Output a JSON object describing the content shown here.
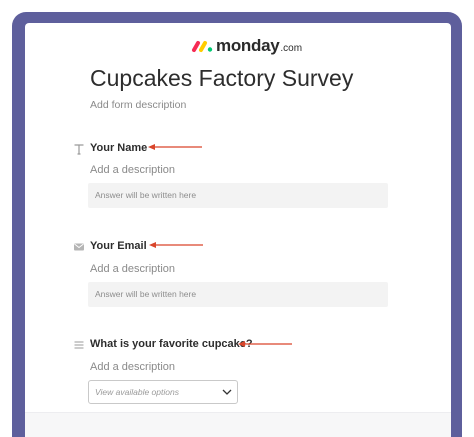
{
  "logo": {
    "word": "monday",
    "domain": ".com"
  },
  "form": {
    "title": "Cupcakes Factory Survey",
    "description": "Add form description"
  },
  "questions": [
    {
      "title": "Your Name",
      "description": "Add a description",
      "icon": "text-icon",
      "answer_placeholder": "Answer will be written here"
    },
    {
      "title": "Your Email",
      "description": "Add a description",
      "icon": "email-icon",
      "answer_placeholder": "Answer will be written here"
    },
    {
      "title": "What is your favorite cupcake?",
      "description": "Add a description",
      "icon": "list-icon",
      "dropdown_placeholder": "View available options"
    }
  ],
  "colors": {
    "frame": "#5e5f9c",
    "arrow": "#d9452b",
    "logo_red": "#f62b54",
    "logo_yellow": "#ffcc00",
    "logo_green": "#00ca72"
  }
}
